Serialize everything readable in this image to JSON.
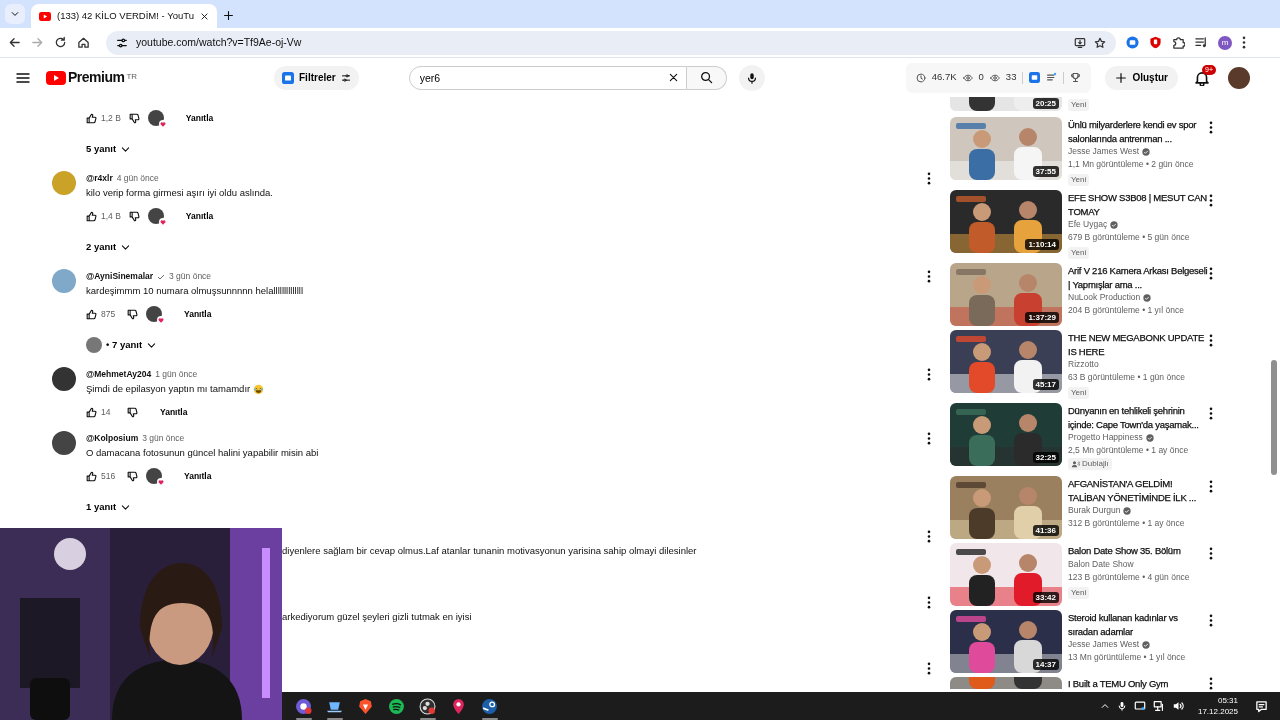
{
  "browser": {
    "tab_title": "(133) 42 KİLO VERDİM! - YouTu",
    "address": "youtube.com/watch?v=Tf9Ae-oj-Vw",
    "profile_initial": "m"
  },
  "header": {
    "logo": "Premium",
    "region": "TR",
    "filter_button": "Filtreler",
    "search": {
      "value": "yer6"
    },
    "stats": [
      {
        "kind": "views",
        "value": "46.7K"
      },
      {
        "kind": "eye",
        "value": "0"
      },
      {
        "kind": "eye",
        "value": "33"
      }
    ],
    "create_button": "Oluştur",
    "notification_badge": "9+"
  },
  "comments": [
    {
      "kind": "partial",
      "likes": "1,2 B",
      "creator_heart": true,
      "reply_label": "Yanıtla",
      "replies": "5 yanıt",
      "replies_avatar": false
    },
    {
      "kind": "full",
      "author": "@r4xlr",
      "verified": false,
      "time": "4 gün önce",
      "text": "kilo verip forma girmesi aşırı iyi oldu aslında.",
      "likes": "1,4 B",
      "creator_heart": true,
      "reply_label": "Yanıtla",
      "replies": "2 yanıt",
      "replies_avatar": false
    },
    {
      "kind": "full",
      "author": "@AyniSinemalar",
      "verified": true,
      "time": "3 gün önce",
      "text": "kardeşimmm 10 numara olmuşsunnnnn helallllllllllllll",
      "likes": "875",
      "creator_heart": true,
      "reply_label": "Yanıtla",
      "replies": "• 7 yanıt",
      "replies_avatar": true
    },
    {
      "kind": "full",
      "author": "@MehmetAy204",
      "verified": false,
      "time": "1 gün önce",
      "text": "Şimdi de epilasyon yaptın mı tamamdır",
      "emoji_icon": true,
      "likes": "14",
      "creator_heart": false,
      "reply_label": "Yanıtla"
    },
    {
      "kind": "full",
      "author": "@Kolposium",
      "verified": false,
      "time": "3 gün önce",
      "text": "O damacana fotosunun güncel halini yapabilir misin abi",
      "likes": "516",
      "creator_heart": true,
      "reply_label": "Yanıtla",
      "replies": "1 yanıt",
      "replies_avatar": false
    },
    {
      "kind": "covered",
      "text": "diyenlere sağlam bir cevap olmus.Laf atanlar tunanin motivasyonun yarisina sahip olmayi dilesinler"
    },
    {
      "kind": "covered",
      "text": "arkediyorum güzel şeyleri gizli tutmak en iyisi"
    },
    {
      "kind": "covered"
    }
  ],
  "related": [
    {
      "kind": "partial",
      "duration": "20:25",
      "badge": {
        "kind": "new",
        "text": "Yeni"
      }
    },
    {
      "kind": "video",
      "title": "Ünlü milyarderlere kendi ev spor salonlarında antrenman ...",
      "channel": "Jesse James West",
      "verified": true,
      "meta": "1,1 Mn görüntüleme • 2 gün önce",
      "duration": "37:55",
      "badge": {
        "kind": "new",
        "text": "Yeni"
      }
    },
    {
      "kind": "video",
      "title": "EFE SHOW S3B08 | MESUT CAN TOMAY",
      "channel": "Efe Uygaç",
      "verified": true,
      "meta": "679 B görüntüleme • 5 gün önce",
      "duration": "1:10:14",
      "badge": {
        "kind": "new",
        "text": "Yeni"
      }
    },
    {
      "kind": "video",
      "title": "Arif V 216 Kamera Arkası Belgeseli | Yapmışlar ama ...",
      "channel": "NuLook Production",
      "verified": true,
      "meta": "204 B görüntüleme • 1 yıl önce",
      "duration": "1:37:29"
    },
    {
      "kind": "video",
      "title": "THE NEW MEGABONK UPDATE IS HERE",
      "channel": "Rizzotto",
      "verified": false,
      "meta": "63 B görüntüleme • 1 gün önce",
      "duration": "45:17",
      "badge": {
        "kind": "new",
        "text": "Yeni"
      }
    },
    {
      "kind": "video",
      "title": "Dünyanın en tehlikeli şehrinin içinde: Cape Town'da yaşamak...",
      "channel": "Progetto Happiness",
      "verified": true,
      "meta": "2,5 Mn görüntüleme • 1 ay önce",
      "duration": "32:25",
      "badge": {
        "kind": "dubbed",
        "text": "Dublajlı"
      }
    },
    {
      "kind": "video",
      "title": "AFGANİSTAN'A GELDİM! TALİBAN YÖNETİMİNDE İLK ...",
      "channel": "Burak Durgun",
      "verified": true,
      "meta": "312 B görüntüleme • 1 ay önce",
      "duration": "41:36"
    },
    {
      "kind": "video",
      "title": "Balon Date Show 35. Bölüm",
      "channel": "Balon Date Show",
      "verified": false,
      "meta": "123 B görüntüleme • 4 gün önce",
      "duration": "33:42",
      "badge": {
        "kind": "new",
        "text": "Yeni"
      }
    },
    {
      "kind": "video",
      "title": "Steroid kullanan kadınlar vs sıradan adamlar",
      "channel": "Jesse James West",
      "verified": true,
      "meta": "13 Mn görüntüleme • 1 yıl önce",
      "duration": "14:37"
    },
    {
      "kind": "cut",
      "title": "I Built a TEMU Only Gym"
    }
  ],
  "taskbar": {
    "time": "05:31",
    "date": "17.12.2025"
  }
}
